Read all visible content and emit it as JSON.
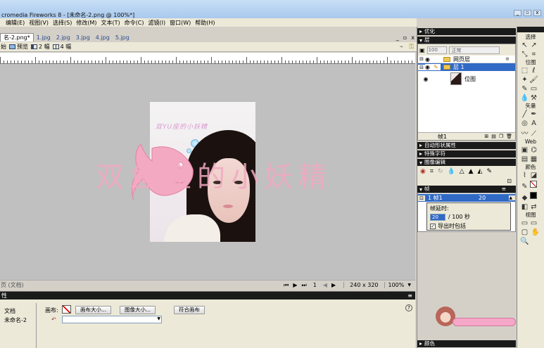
{
  "window": {
    "title": "cromedia Fireworks 8 - [未命名-2.png @ 100%*]"
  },
  "menubar": [
    "编辑(E)",
    "视图(V)",
    "选择(S)",
    "修改(M)",
    "文本(T)",
    "命令(C)",
    "滤镜(I)",
    "窗口(W)",
    "帮助(H)"
  ],
  "doc_tabs": [
    "名-2.png*",
    "1.jpg",
    "2.jpg",
    "3.jpg",
    "4.jpg",
    "5.jpg"
  ],
  "view_tabs": {
    "prefix": "始",
    "preview": "预览",
    "two_up": "2 幅",
    "four_up": "4 幅"
  },
  "canvas": {
    "watermark": "双鱼座的小妖精",
    "photo_caption": "双YU座的小妖精"
  },
  "statusbar": {
    "left": "页 (文档)",
    "frame": "1",
    "size": "240 x 320",
    "zoom": "100%"
  },
  "properties": {
    "header": "性",
    "doc_type": "文档",
    "doc_name": "未命名-2",
    "canvas_label": "画布:",
    "canvas_size_btn": "画布大小...",
    "image_size_btn": "图像大小...",
    "fit_canvas_btn": "符合画布"
  },
  "optimize_panel": {
    "title": "优化"
  },
  "layers_panel": {
    "title": "层",
    "opacity": "100",
    "blend": "正常",
    "rows": [
      {
        "name": "网页层"
      },
      {
        "name": "层 1"
      },
      {
        "name": "位图"
      }
    ],
    "footer": "帧1"
  },
  "collapsed_panels": [
    "自动形状属性",
    "特殊字符",
    "图像编辑"
  ],
  "frames_panel": {
    "title": "帧",
    "frame_name": "1 帧1",
    "frame_delay": "20",
    "delay_label": "帧延时:",
    "delay_value": "20",
    "delay_unit": "/ 100 秒",
    "export_checkbox": "导出时包括"
  },
  "colors_panel": {
    "title": "颜色"
  },
  "tools": {
    "select": "选择",
    "bitmap": "位图",
    "vector": "矢量",
    "web": "Web",
    "colors": "颜色",
    "view": "视图"
  },
  "colors": {
    "canvas_bg": "#c0c0c0",
    "watermark_pink": "#f2a9c2",
    "panel_dark": "#1a1a1a",
    "selection_blue": "#316ac5"
  }
}
